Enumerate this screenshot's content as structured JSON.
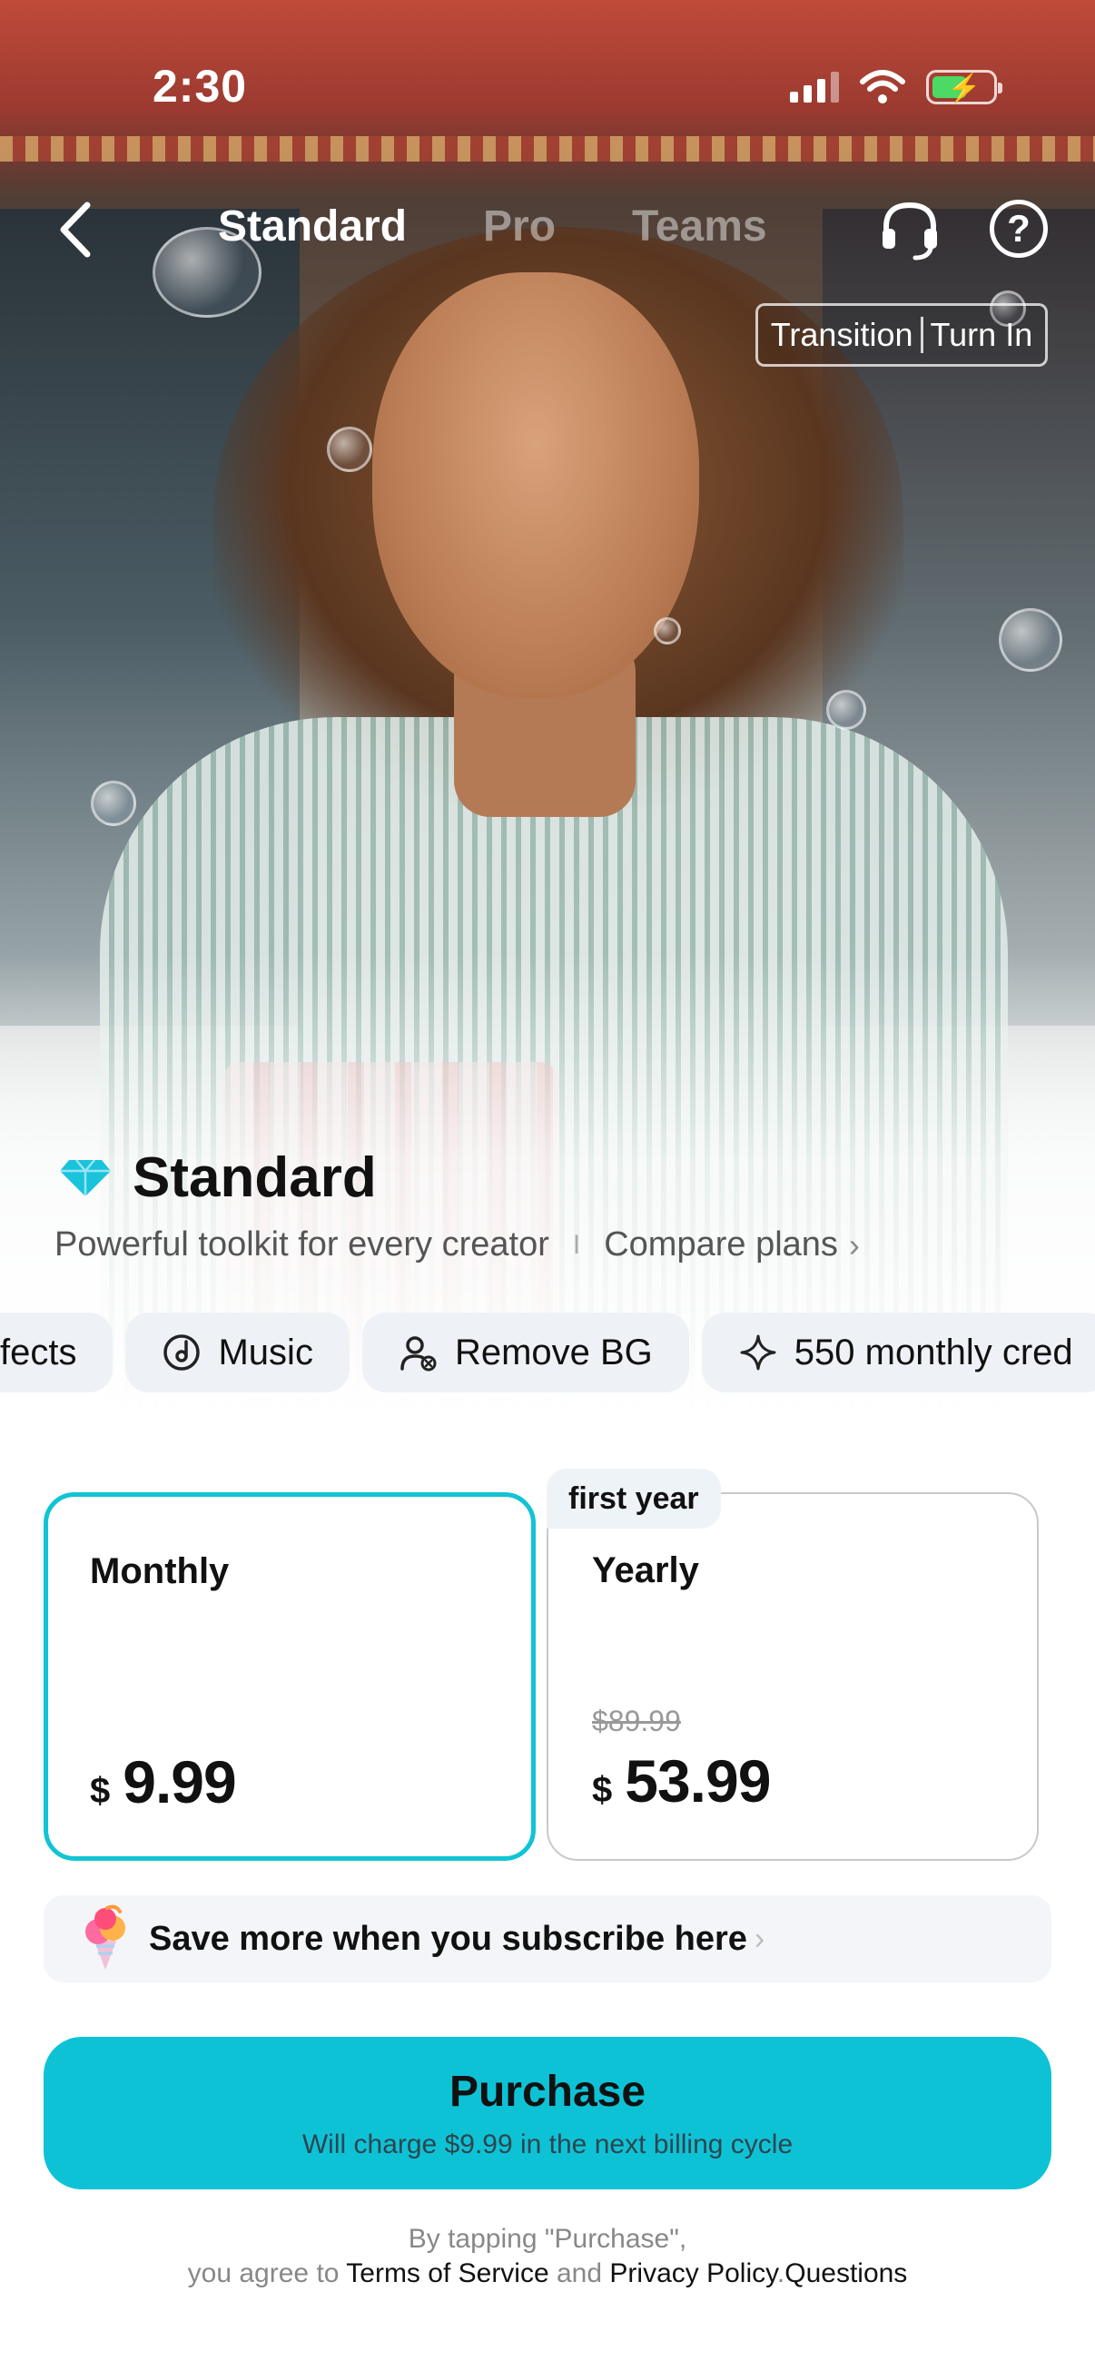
{
  "status_bar": {
    "time": "2:30"
  },
  "nav": {
    "tabs": [
      {
        "label": "Standard",
        "active": true
      },
      {
        "label": "Pro",
        "active": false
      },
      {
        "label": "Teams",
        "active": false
      }
    ],
    "icons": [
      "back-chevron-icon",
      "headset-icon",
      "help-icon"
    ]
  },
  "hero": {
    "tag_left": "Transition",
    "tag_right": "Turn In"
  },
  "plan": {
    "title": "Standard",
    "subtitle": "Powerful toolkit for every creator",
    "separator": "I",
    "compare_label": "Compare plans"
  },
  "features": [
    {
      "label": "fects",
      "icon": ""
    },
    {
      "label": "Music",
      "icon": "music-disc-icon"
    },
    {
      "label": "Remove BG",
      "icon": "person-remove-icon"
    },
    {
      "label": "550 monthly cred",
      "icon": "sparkle-icon"
    }
  ],
  "pricing": {
    "monthly": {
      "name": "Monthly",
      "currency": "$",
      "amount": "9.99",
      "selected": true
    },
    "yearly": {
      "badge": "first year",
      "name": "Yearly",
      "old_price": "$89.99",
      "currency": "$",
      "amount": "53.99",
      "selected": false
    }
  },
  "promo": {
    "text": "Save more when you subscribe here"
  },
  "purchase": {
    "label": "Purchase",
    "subtext": "Will charge $9.99 in the next billing cycle"
  },
  "legal": {
    "line1": "By tapping \"Purchase\",",
    "prefix": "you agree to",
    "terms": "Terms of Service",
    "and": "and",
    "privacy": "Privacy Policy",
    "dot": ".",
    "questions": "Questions"
  },
  "colors": {
    "accent": "#0ec2d6",
    "selected_border": "#10c4d4",
    "chip_bg": "#eef2f7"
  }
}
